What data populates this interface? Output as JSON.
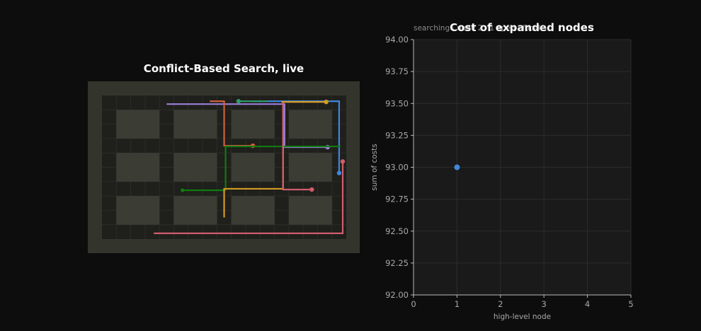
{
  "grid_panel": {
    "title": "Conflict-Based Search, live",
    "colors": {
      "frame": "#33352d",
      "floor": "#1f1f1c",
      "cell_line": "#2b2b27",
      "obstacle": "#3b3c34"
    },
    "cols": 17,
    "rows": 10,
    "obstacles": [
      [
        1,
        1,
        3,
        2
      ],
      [
        5,
        1,
        3,
        2
      ],
      [
        9,
        1,
        3,
        2
      ],
      [
        13,
        1,
        3,
        2
      ],
      [
        1,
        4,
        3,
        2
      ],
      [
        5,
        4,
        3,
        2
      ],
      [
        9,
        4,
        3,
        2
      ],
      [
        13,
        4,
        3,
        2
      ],
      [
        1,
        7,
        3,
        2
      ],
      [
        5,
        7,
        3,
        2
      ],
      [
        9,
        7,
        3,
        2
      ],
      [
        13,
        7,
        3,
        2
      ]
    ],
    "agents": [
      {
        "color": "#9b7fd6",
        "path": [
          [
            4.5,
            0.6
          ],
          [
            12.7,
            0.6
          ],
          [
            12.7,
            3.6
          ],
          [
            15.7,
            3.6
          ]
        ],
        "start": null,
        "goal": [
          15.7,
          3.6
        ]
      },
      {
        "color": "#3f88d8",
        "path": [
          [
            10.5,
            0.4
          ],
          [
            16.5,
            0.4
          ],
          [
            16.5,
            5.4
          ]
        ],
        "start": null,
        "goal": [
          16.5,
          5.4
        ]
      },
      {
        "color": "#d39a23",
        "path": [
          [
            12.5,
            0.45
          ],
          [
            15.6,
            0.45
          ]
        ],
        "start": null,
        "goal": [
          15.6,
          0.45
        ]
      },
      {
        "color": "#2e9a6a",
        "path": [
          [
            9.5,
            0.4
          ],
          [
            11.5,
            0.4
          ]
        ],
        "start": null,
        "goal": [
          9.5,
          0.4
        ]
      },
      {
        "color": "#d0603c",
        "path": [
          [
            7.5,
            0.4
          ],
          [
            8.5,
            0.4
          ],
          [
            8.5,
            3.5
          ],
          [
            10.5,
            3.5
          ]
        ],
        "start": null,
        "goal": [
          10.5,
          3.5
        ]
      },
      {
        "color": "#0f7c0f",
        "path": [
          [
            8.6,
            6.6
          ],
          [
            8.6,
            3.55
          ],
          [
            16.6,
            3.55
          ]
        ],
        "start": null,
        "goal": null
      },
      {
        "color": "#0f7c0f",
        "path": [
          [
            5.6,
            6.6
          ],
          [
            8.6,
            6.6
          ]
        ],
        "start": [
          5.6,
          6.6
        ],
        "goal": null
      },
      {
        "color": "#d39a23",
        "path": [
          [
            8.5,
            8.5
          ],
          [
            8.5,
            6.5
          ],
          [
            12.6,
            6.5
          ],
          [
            12.6,
            0.5
          ]
        ],
        "start": null,
        "goal": null
      },
      {
        "color": "#d05c6c",
        "path": [
          [
            3.6,
            9.6
          ],
          [
            16.75,
            9.6
          ],
          [
            16.75,
            4.6
          ]
        ],
        "start": null,
        "goal": [
          16.75,
          4.6
        ]
      },
      {
        "color": "#d05c6c",
        "path": [
          [
            12.6,
            0.5
          ],
          [
            12.6,
            6.55
          ],
          [
            14.6,
            6.55
          ]
        ],
        "start": null,
        "goal": [
          14.6,
          6.55
        ]
      }
    ]
  },
  "chart_subtitle": "searching · node 2 · 1 open · focal ...",
  "chart_data": {
    "type": "scatter",
    "title": "Cost of expanded nodes",
    "xlabel": "high-level node",
    "ylabel": "sum of costs",
    "xlim": [
      0,
      5
    ],
    "ylim": [
      92.0,
      94.0
    ],
    "xticks": [
      "0",
      "1",
      "2",
      "3",
      "4",
      "5"
    ],
    "yticks": [
      "92.00",
      "92.25",
      "92.50",
      "92.75",
      "93.00",
      "93.25",
      "93.50",
      "93.75",
      "94.00"
    ],
    "grid": true,
    "series": [
      {
        "points": [
          {
            "x": 1,
            "y": 93.0
          }
        ],
        "color": "#3f88d8"
      }
    ],
    "colors": {
      "plot_bg": "#1a1a1a",
      "grid": "#2c2c2c",
      "axis": "#bbbbbb"
    }
  }
}
